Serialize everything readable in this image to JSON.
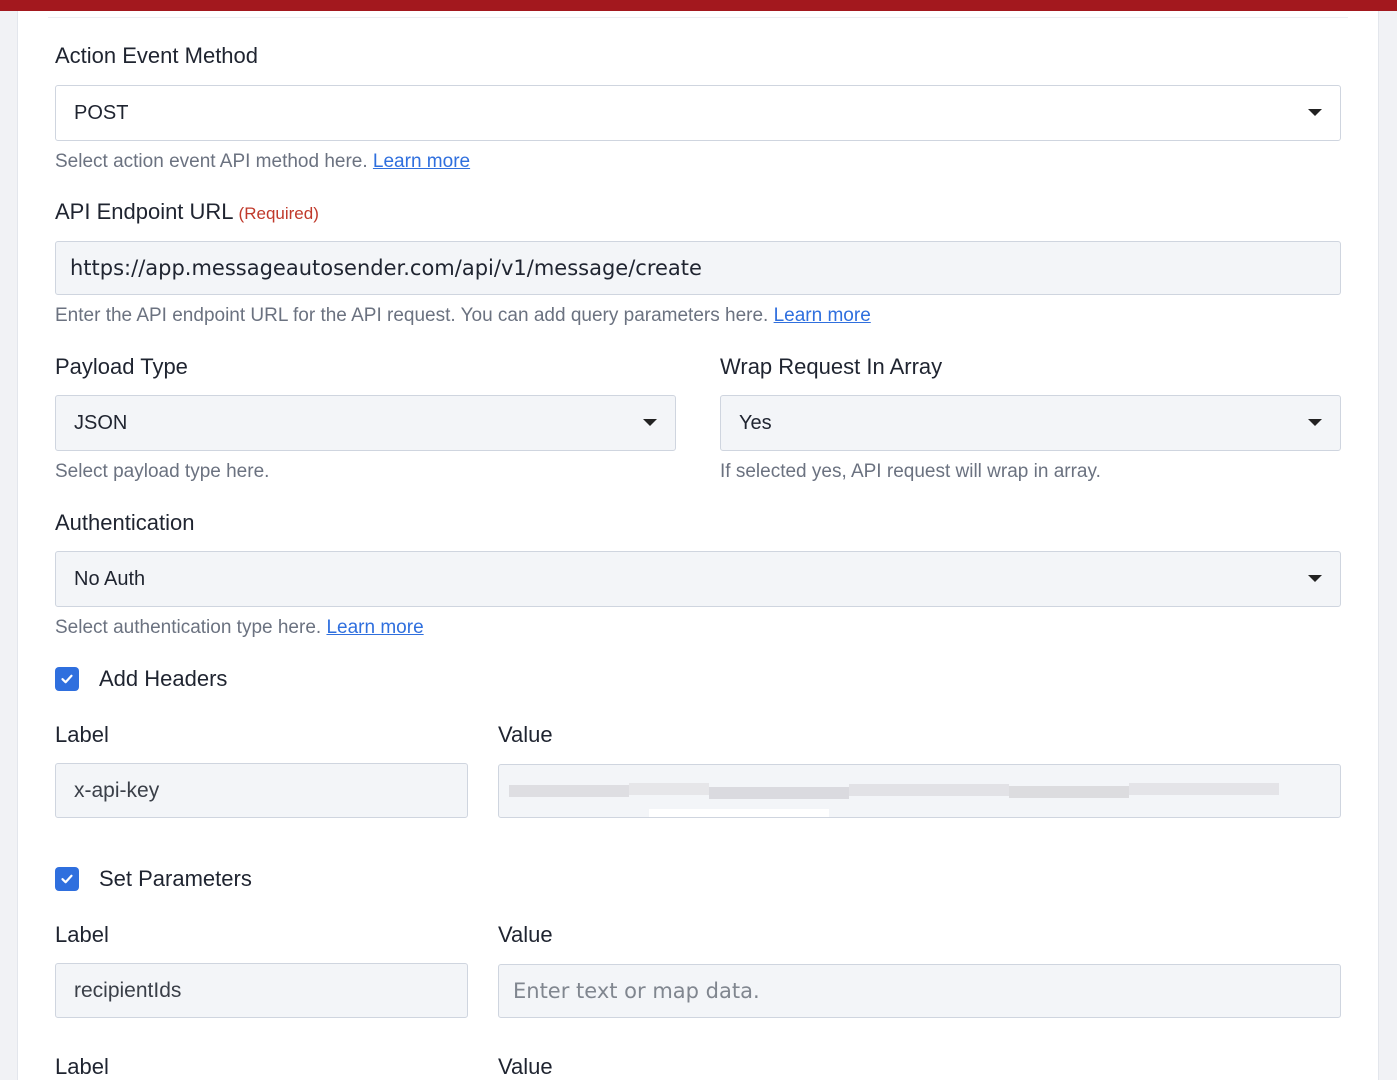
{
  "method": {
    "label": "Action Event Method",
    "value": "POST",
    "help": "Select action event API method here.",
    "help_link": "Learn more"
  },
  "endpoint": {
    "label": "API Endpoint URL",
    "required": "(Required)",
    "value": "https://app.messageautosender.com/api/v1/message/create",
    "help": "Enter the API endpoint URL for the API request. You can add query parameters here.",
    "help_link": "Learn more"
  },
  "payload": {
    "label": "Payload Type",
    "value": "JSON",
    "help": "Select payload type here."
  },
  "wrap": {
    "label": "Wrap Request In Array",
    "value": "Yes",
    "help": "If selected yes, API request will wrap in array."
  },
  "auth": {
    "label": "Authentication",
    "value": "No Auth",
    "help": "Select authentication type here.",
    "help_link": "Learn more"
  },
  "headers": {
    "checkbox_label": "Add Headers",
    "checked": true,
    "label_heading": "Label",
    "value_heading": "Value",
    "row_label": "x-api-key"
  },
  "parameters": {
    "checkbox_label": "Set Parameters",
    "checked": true,
    "label_heading": "Label",
    "value_heading": "Value",
    "row_label": "recipientIds",
    "value_placeholder": "Enter text or map data.",
    "next_label_heading": "Label",
    "next_value_heading": "Value"
  },
  "colors": {
    "top_bar": "#a3181e",
    "accent": "#2f6fde",
    "required": "#c0392b"
  }
}
